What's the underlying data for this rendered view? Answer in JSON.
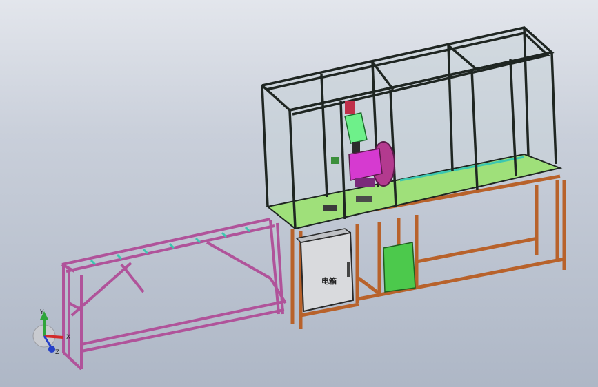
{
  "model": {
    "electrical_box_label": "电箱"
  },
  "triad": {
    "y_label": "Y",
    "x_label": "X",
    "z_label": "Z"
  },
  "colors": {
    "background_top": "#e3e6ec",
    "background_bottom": "#aeb7c6",
    "conveyor_frame": "#b0539a",
    "conveyor_rollers": "#3cc7b0",
    "base_frame": "#b8622b",
    "enclosure_frame": "#1f2622",
    "enclosure_glass": "#c8d3d8",
    "work_table": "#9fe07a",
    "electrical_box": "#d9dadd",
    "green_cabinet": "#4cc94c",
    "cylinder": "#6ef08a",
    "saw_head": "#d63ad0",
    "saw_blade": "#b33a8f"
  }
}
